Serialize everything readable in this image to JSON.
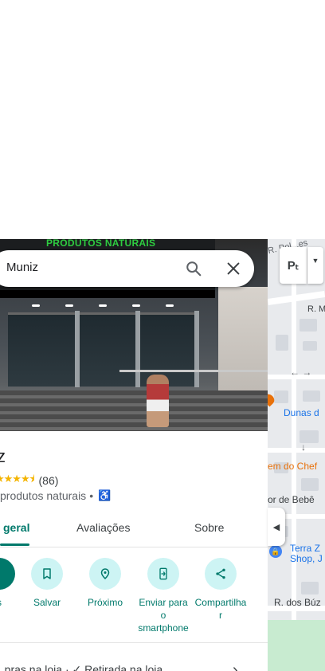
{
  "search": {
    "value": "Muniz"
  },
  "place": {
    "title": "z",
    "rating": "(86)",
    "stars": "★★★★⯨",
    "category": "produtos naturais",
    "separator": "•",
    "sign_text": "PRODUTOS NATURAIS"
  },
  "tabs": [
    {
      "label": "geral"
    },
    {
      "label": "Avaliações"
    },
    {
      "label": "Sobre"
    }
  ],
  "actions": [
    {
      "label": "s",
      "icon": "directions-icon"
    },
    {
      "label": "Salvar",
      "icon": "bookmark-icon"
    },
    {
      "label": "Próximo",
      "icon": "nearby-icon"
    },
    {
      "label": "Enviar para o smartphone",
      "icon": "send-to-phone-icon"
    },
    {
      "label": "Compartilhar",
      "icon": "share-icon"
    }
  ],
  "actions_display": {
    "enviar_line1": "Enviar para",
    "enviar_line2": "o",
    "enviar_line3": "smartphone",
    "compart_line1": "Compartilha",
    "compart_line2": "r"
  },
  "services": {
    "text": "...pras na loja · ✓ Retirada na loja"
  },
  "map": {
    "labels": {
      "street_top": "R. Pol...es",
      "street_r_m": "R. M",
      "dunas": "Dunas d",
      "chef": "em do Chef",
      "bebe": "or de Bebê",
      "terra1": "Terra Z",
      "terra2": "Shop, J",
      "buz": "R. dos Búz"
    },
    "layer_label": "Pₜ",
    "colors": {
      "land": "#e8eaed",
      "park": "#c8ebd0",
      "pin": "#e8710a",
      "bag_pin": "#4285f4"
    }
  }
}
